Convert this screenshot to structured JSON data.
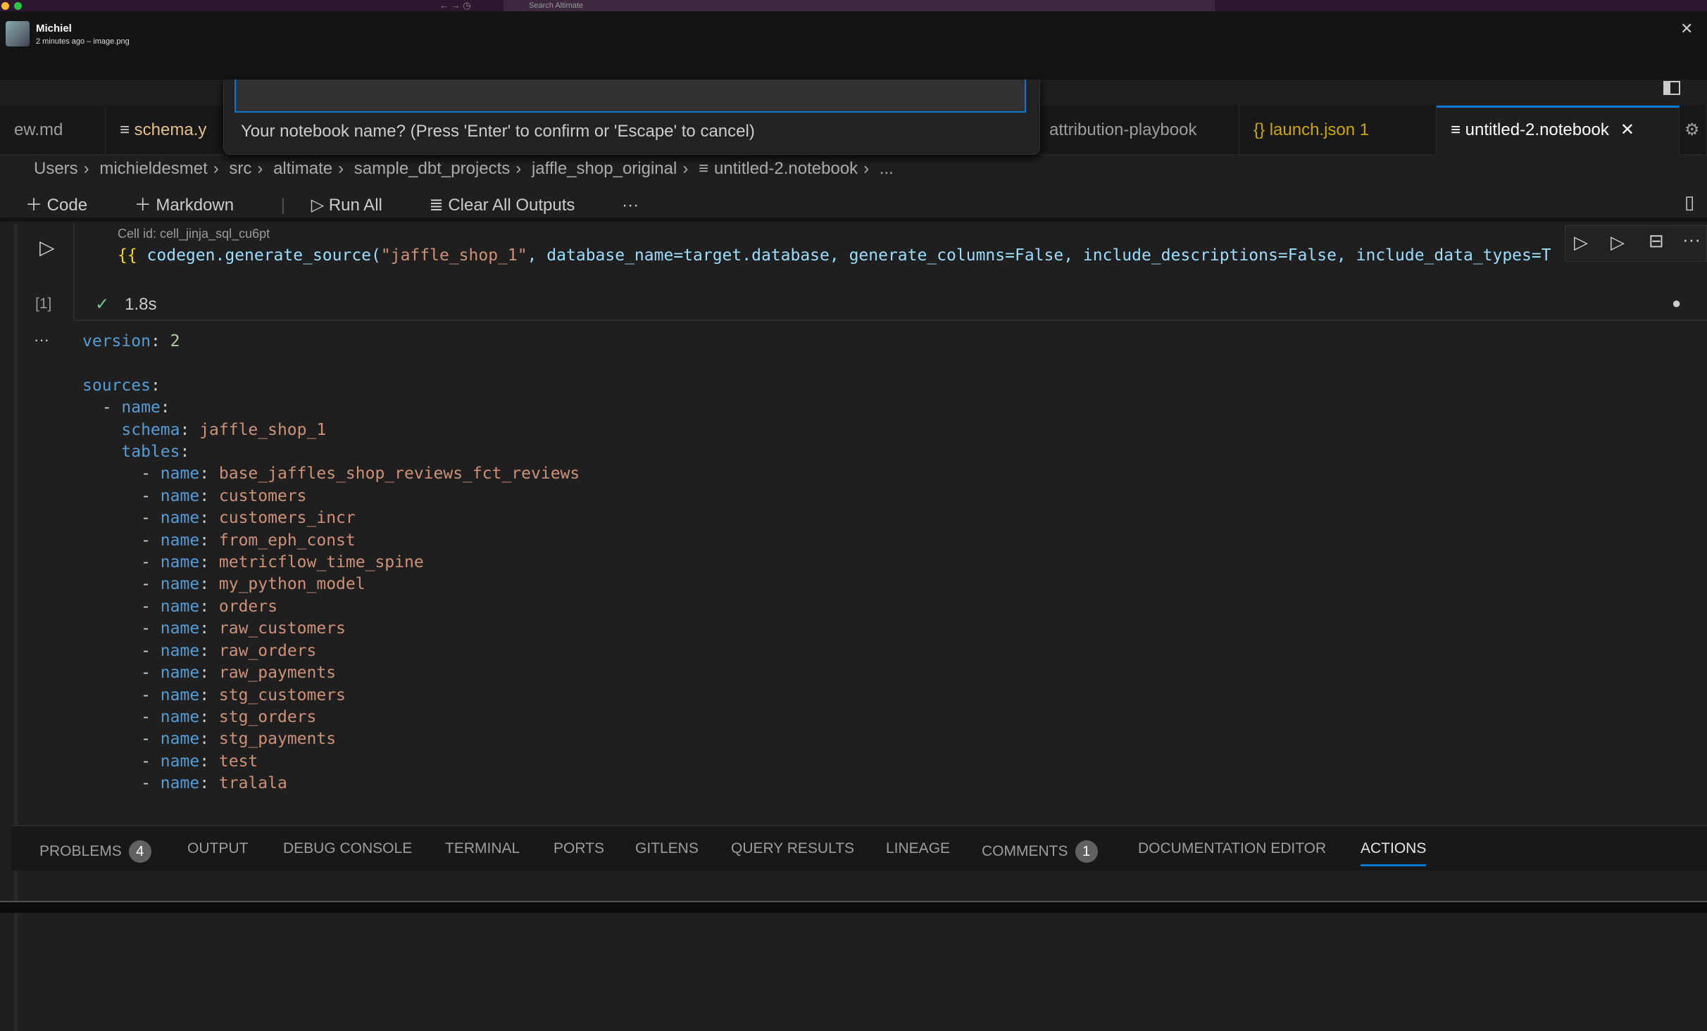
{
  "os": {
    "search_placeholder": "Search Altimate"
  },
  "notification": {
    "name": "Michiel",
    "subtitle": "2 minutes ago – image.png"
  },
  "tabs": [
    {
      "label": "ew.md",
      "color": "#9d9d9d"
    },
    {
      "label": "schema.y",
      "color": "#e2c08d"
    },
    {
      "label": "attribution-playbook",
      "color": "#9d9d9d"
    },
    {
      "label": "launch.json 1",
      "color": "#cca700"
    },
    {
      "label": "untitled-2.notebook",
      "color": "#ffffff",
      "active": true
    }
  ],
  "quick_input": {
    "value": "",
    "message": "Your notebook name? (Press 'Enter' to confirm or 'Escape' to cancel)"
  },
  "breadcrumb": [
    "Users",
    "michieldesmet",
    "src",
    "altimate",
    "sample_dbt_projects",
    "jaffle_shop_original",
    "untitled-2.notebook",
    "..."
  ],
  "toolbar": {
    "code": "Code",
    "markdown": "Markdown",
    "run_all": "Run All",
    "clear": "Clear All Outputs",
    "more": "···"
  },
  "cell": {
    "id_label": "Cell id: cell_jinja_sql_cu6pt",
    "code_open": "{{ ",
    "code_fn": "codegen.generate_source(",
    "code_arg": "\"jaffle_shop_1\"",
    "code_rest": ", database_name=target.database, generate_columns=False, include_descriptions=False, include_data_types=T",
    "exec_count": "[1]",
    "duration": "1.8s"
  },
  "output": {
    "version_key": "version",
    "version_val": "2",
    "sources_key": "sources",
    "name_key": "name",
    "schema_key": "schema",
    "schema_val": "jaffle_shop_1",
    "tables_key": "tables",
    "tables": [
      "base_jaffles_shop_reviews_fct_reviews",
      "customers",
      "customers_incr",
      "from_eph_const",
      "metricflow_time_spine",
      "my_python_model",
      "orders",
      "raw_customers",
      "raw_orders",
      "raw_payments",
      "stg_customers",
      "stg_orders",
      "stg_payments",
      "test",
      "tralala"
    ]
  },
  "panel": {
    "tabs": [
      {
        "label": "PROBLEMS",
        "badge": "4"
      },
      {
        "label": "OUTPUT"
      },
      {
        "label": "DEBUG CONSOLE"
      },
      {
        "label": "TERMINAL"
      },
      {
        "label": "PORTS"
      },
      {
        "label": "GITLENS"
      },
      {
        "label": "QUERY RESULTS"
      },
      {
        "label": "LINEAGE"
      },
      {
        "label": "COMMENTS",
        "badge": "1"
      },
      {
        "label": "DOCUMENTATION EDITOR"
      },
      {
        "label": "ACTIONS",
        "active": true
      }
    ]
  }
}
